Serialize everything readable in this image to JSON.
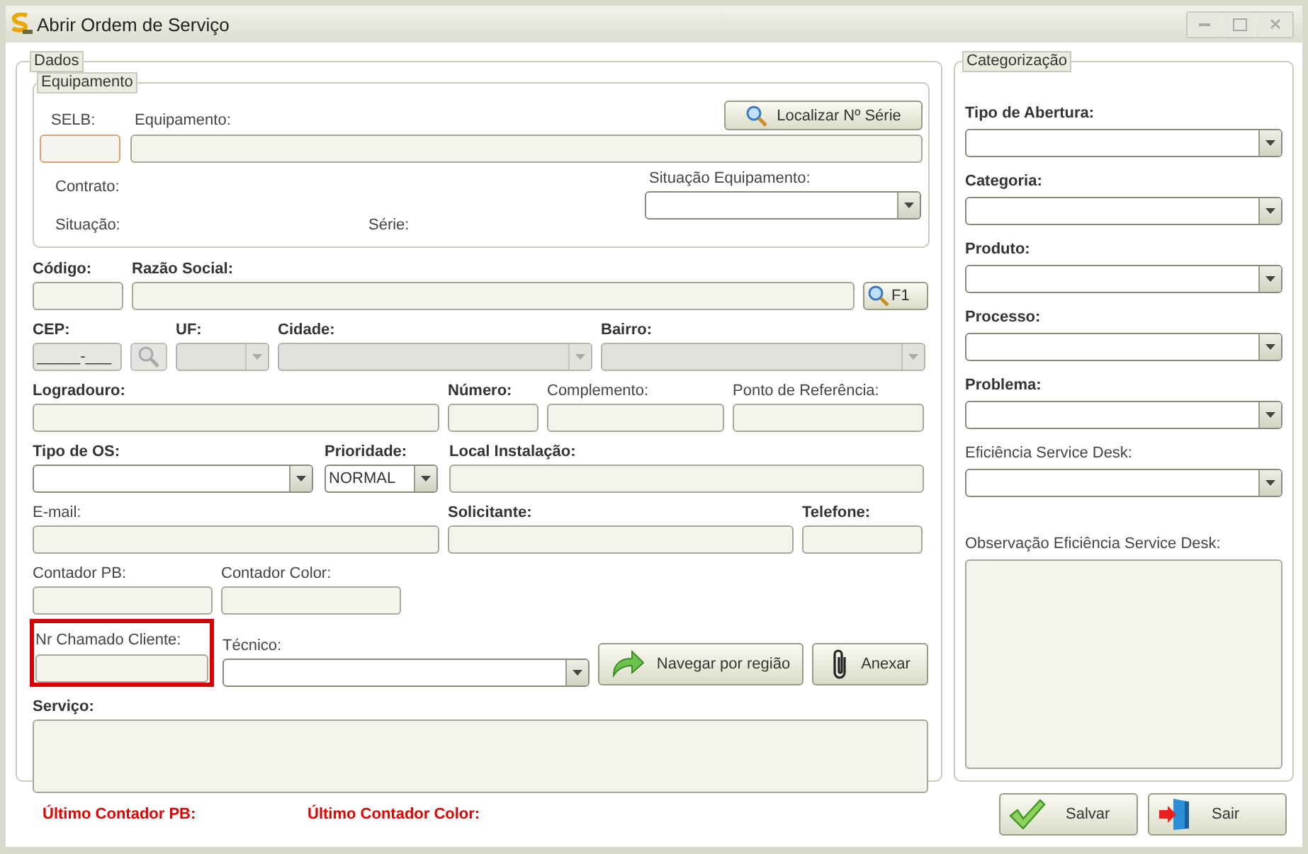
{
  "window": {
    "title": "Abrir Ordem de Serviço"
  },
  "dados": {
    "legend": "Dados",
    "equipamento": {
      "legend": "Equipamento",
      "selb_label": "SELB:",
      "equipamento_label": "Equipamento:",
      "search_button": "Localizar Nº  Série",
      "contrato_label": "Contrato:",
      "situacao_label": "Situação:",
      "serie_label": "Série:",
      "situacao_equipamento_label": "Situação Equipamento:"
    },
    "rows": [
      [
        {
          "kind": "text",
          "label": "Código:",
          "bold": true,
          "disabled": false,
          "highlighted": false
        },
        {
          "kind": "text",
          "label": "Razão Social:",
          "bold": true,
          "disabled": false,
          "highlighted": false
        },
        {
          "kind": "search-button",
          "label": "F1",
          "disabled": false,
          "highlighted": false
        }
      ],
      [
        {
          "kind": "text",
          "label": "CEP:",
          "bold": true,
          "value": "_____-___",
          "disabled": true,
          "highlighted": false
        },
        {
          "kind": "lookup-button",
          "disabled": true,
          "highlighted": false
        },
        {
          "kind": "combo",
          "label": "UF:",
          "bold": true,
          "disabled": true,
          "highlighted": false
        },
        {
          "kind": "combo",
          "label": "Cidade:",
          "bold": true,
          "disabled": true,
          "highlighted": false
        },
        {
          "kind": "combo",
          "label": "Bairro:",
          "bold": true,
          "disabled": true,
          "highlighted": false
        }
      ],
      [
        {
          "kind": "text",
          "label": "Logradouro:",
          "bold": true,
          "disabled": false,
          "highlighted": false
        },
        {
          "kind": "text",
          "label": "Número:",
          "bold": true,
          "disabled": false,
          "highlighted": false
        },
        {
          "kind": "text",
          "label": "Complemento:",
          "bold": false,
          "disabled": false,
          "highlighted": false
        },
        {
          "kind": "text",
          "label": "Ponto de Referência:",
          "bold": false,
          "disabled": false,
          "highlighted": false
        }
      ],
      [
        {
          "kind": "combo",
          "label": "Tipo de OS:",
          "bold": true,
          "disabled": false,
          "highlighted": false
        },
        {
          "kind": "combo",
          "label": "Prioridade:",
          "bold": true,
          "value": "NORMAL",
          "disabled": false,
          "highlighted": false
        },
        {
          "kind": "text",
          "label": "Local Instalação:",
          "bold": true,
          "disabled": false,
          "highlighted": false
        }
      ],
      [
        {
          "kind": "text",
          "label": "E-mail:",
          "bold": false,
          "disabled": false,
          "highlighted": false
        },
        {
          "kind": "text",
          "label": "Solicitante:",
          "bold": true,
          "disabled": false,
          "highlighted": false
        },
        {
          "kind": "text",
          "label": "Telefone:",
          "bold": true,
          "disabled": false,
          "highlighted": false
        }
      ],
      [
        {
          "kind": "text",
          "label": "Contador PB:",
          "bold": false,
          "disabled": false,
          "highlighted": false
        },
        {
          "kind": "text",
          "label": "Contador Color:",
          "bold": false,
          "disabled": false,
          "highlighted": false
        }
      ],
      [
        {
          "kind": "text",
          "label": "Nr Chamado Cliente:",
          "bold": false,
          "disabled": false,
          "highlighted": true
        },
        {
          "kind": "combo",
          "label": "Técnico:",
          "bold": false,
          "disabled": false,
          "highlighted": false
        },
        {
          "kind": "region-button",
          "label": "Navegar por região",
          "disabled": false,
          "highlighted": false
        },
        {
          "kind": "attach-button",
          "label": "Anexar",
          "disabled": false,
          "highlighted": false
        }
      ],
      [
        {
          "kind": "textarea",
          "label": "Serviço:",
          "bold": true,
          "disabled": false,
          "highlighted": false
        }
      ]
    ]
  },
  "categorizacao": {
    "legend": "Categorização",
    "fields": [
      {
        "kind": "combo",
        "label": "Tipo de Abertura:",
        "bold": true
      },
      {
        "kind": "combo",
        "label": "Categoria:",
        "bold": true
      },
      {
        "kind": "combo",
        "label": "Produto:",
        "bold": true
      },
      {
        "kind": "combo",
        "label": "Processo:",
        "bold": true
      },
      {
        "kind": "combo",
        "label": "Problema:",
        "bold": true
      },
      {
        "kind": "combo",
        "label": "Eficiência Service Desk:",
        "bold": false
      },
      {
        "kind": "textarea",
        "label": "Observação Eficiência Service Desk:",
        "bold": false
      }
    ]
  },
  "footer": {
    "labels": [
      "Último Contador PB:",
      "Último Contador Color:"
    ],
    "buttons": [
      {
        "kind": "save",
        "label": "Salvar"
      },
      {
        "kind": "exit",
        "label": "Sair"
      }
    ]
  }
}
